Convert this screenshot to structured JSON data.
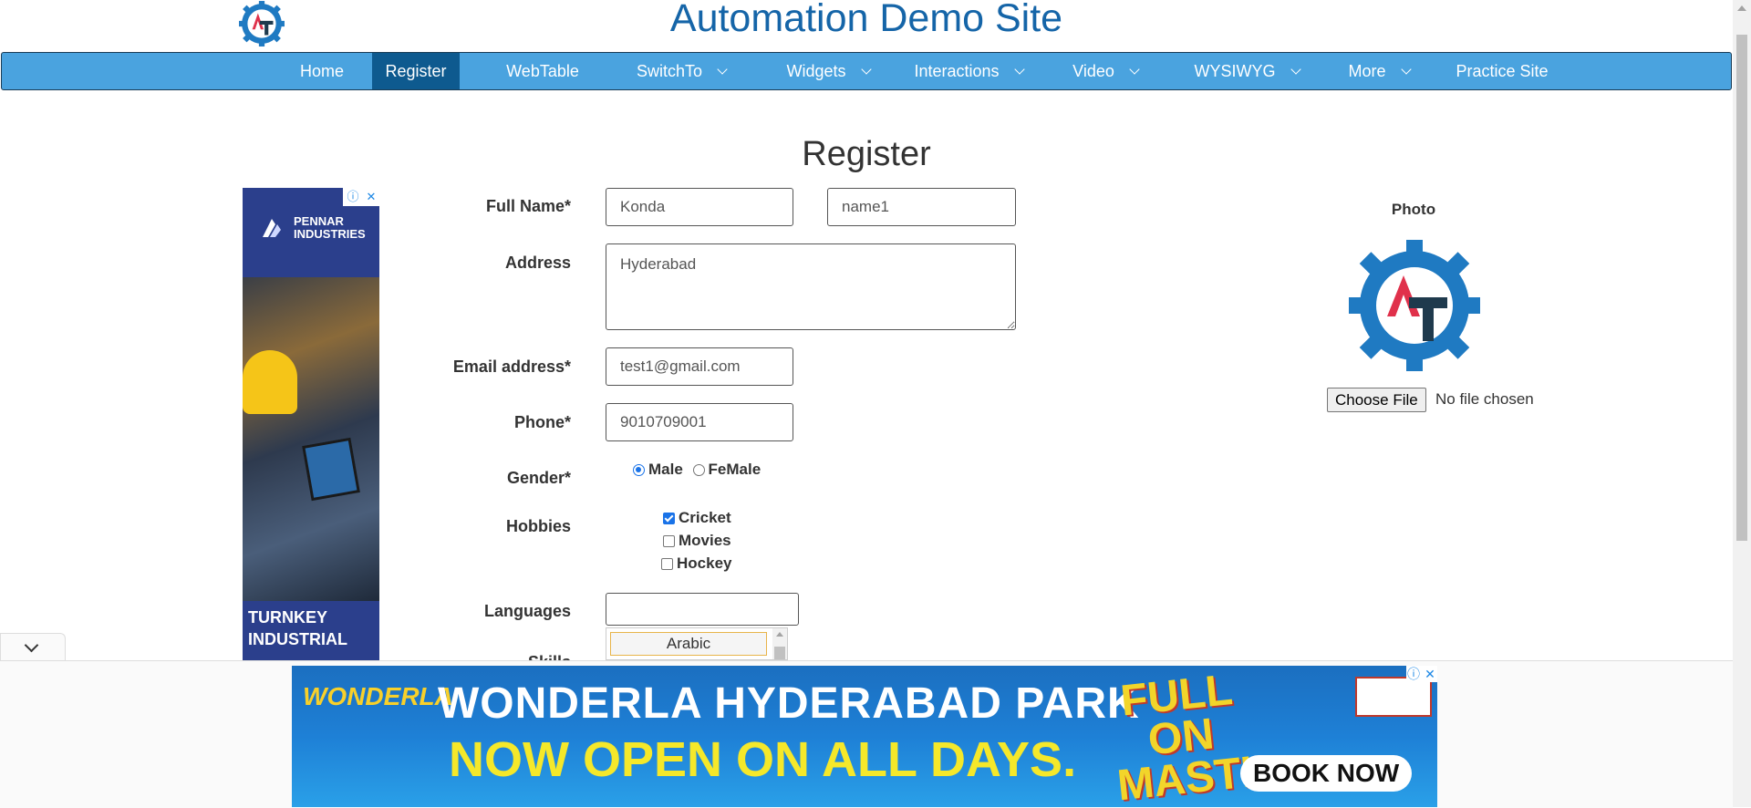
{
  "header": {
    "title": "Automation Demo Site"
  },
  "nav": {
    "items": [
      {
        "label": "Home",
        "dropdown": false,
        "active": false
      },
      {
        "label": "Register",
        "dropdown": false,
        "active": true
      },
      {
        "label": "WebTable",
        "dropdown": false,
        "active": false
      },
      {
        "label": "SwitchTo",
        "dropdown": true,
        "active": false
      },
      {
        "label": "Widgets",
        "dropdown": true,
        "active": false
      },
      {
        "label": "Interactions",
        "dropdown": true,
        "active": false
      },
      {
        "label": "Video",
        "dropdown": true,
        "active": false
      },
      {
        "label": "WYSIWYG",
        "dropdown": true,
        "active": false
      },
      {
        "label": "More",
        "dropdown": true,
        "active": false
      },
      {
        "label": "Practice Site",
        "dropdown": false,
        "active": false
      }
    ]
  },
  "page": {
    "heading": "Register"
  },
  "form": {
    "full_name_label": "Full Name*",
    "first_name_value": "Konda",
    "last_name_value": "name1",
    "address_label": "Address",
    "address_value": "Hyderabad",
    "email_label": "Email address*",
    "email_value": "test1@gmail.com",
    "phone_label": "Phone*",
    "phone_value": "9010709001",
    "gender_label": "Gender*",
    "gender_options": [
      "Male",
      "FeMale"
    ],
    "gender_selected": "Male",
    "hobbies_label": "Hobbies",
    "hobbies": [
      {
        "label": "Cricket",
        "checked": true
      },
      {
        "label": "Movies",
        "checked": false
      },
      {
        "label": "Hockey",
        "checked": false
      }
    ],
    "languages_label": "Languages",
    "languages_value": "",
    "language_option_visible": "Arabic",
    "skills_label": "Skills"
  },
  "photo": {
    "label": "Photo",
    "choose_file_label": "Choose File",
    "file_status": "No file chosen"
  },
  "left_ad": {
    "brand": "PENNAR INDUSTRIES",
    "tagline": "TURNKEY INDUSTRIAL"
  },
  "bottom_ad": {
    "brand": "WONDERLA",
    "headline": "WONDERLA HYDERABAD PARK",
    "subheadline": "NOW OPEN ON ALL DAYS.",
    "tagline": "FULL ON MASTI",
    "cta": "BOOK NOW"
  },
  "colors": {
    "nav_bg": "#4aa3df",
    "nav_active": "#0e5a8f",
    "title": "#1565a8",
    "logo_blue": "#1f7ac2",
    "logo_red": "#e0314b",
    "logo_dark": "#1f3a4d"
  },
  "icons": {
    "logo": "gear-at-logo-icon",
    "dropdown": "chevron-down-icon",
    "ad_info": "info-icon",
    "ad_close": "close-icon",
    "collapse": "chevron-down-icon"
  }
}
